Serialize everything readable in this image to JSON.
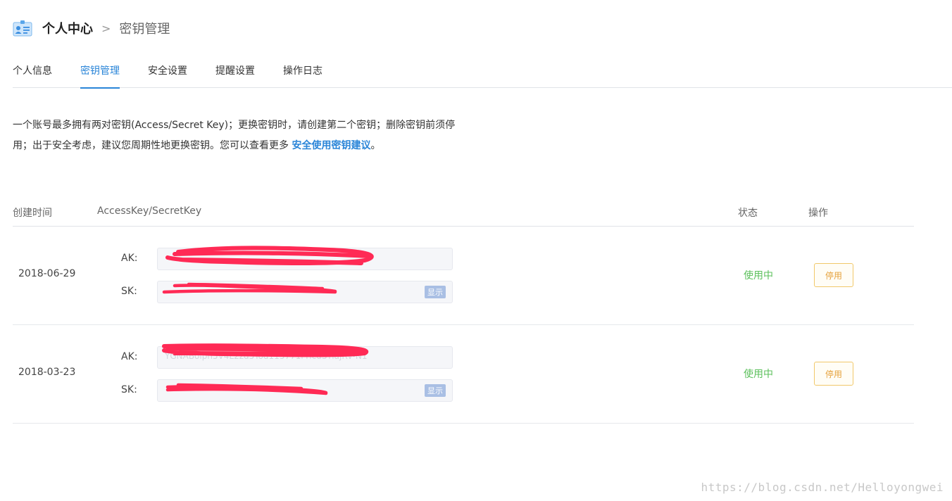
{
  "header": {
    "title": "个人中心",
    "separator": ">",
    "current": "密钥管理"
  },
  "tabs": [
    {
      "label": "个人信息",
      "active": false
    },
    {
      "label": "密钥管理",
      "active": true
    },
    {
      "label": "安全设置",
      "active": false
    },
    {
      "label": "提醒设置",
      "active": false
    },
    {
      "label": "操作日志",
      "active": false
    }
  ],
  "description": {
    "text": "一个账号最多拥有两对密钥(Access/Secret Key)；更换密钥时，请创建第二个密钥；删除密钥前须停用；出于安全考虑，建议您周期性地更换密钥。您可以查看更多 ",
    "link": "安全使用密钥建议",
    "end": "。"
  },
  "table": {
    "headers": {
      "created": "创建时间",
      "keys": "AccessKey/SecretKey",
      "status": "状态",
      "action": "操作"
    },
    "rows": [
      {
        "date": "2018-06-29",
        "ak_label": "AK:",
        "sk_label": "SK:",
        "ak_value": "",
        "show": "显示",
        "status": "使用中",
        "action": "停用"
      },
      {
        "date": "2018-03-23",
        "ak_label": "AK:",
        "sk_label": "SK:",
        "ak_value": "YGNABoiph5V4L2zd5Tod115771rTicuSYiajRV-N1",
        "show": "显示",
        "status": "使用中",
        "action": "停用"
      }
    ]
  },
  "watermark": "https://blog.csdn.net/Helloyongwei",
  "colors": {
    "accent": "#2a85d8",
    "status_active": "#5cc05c",
    "disable_border": "#f1c86a",
    "redaction": "#ff2a55"
  }
}
